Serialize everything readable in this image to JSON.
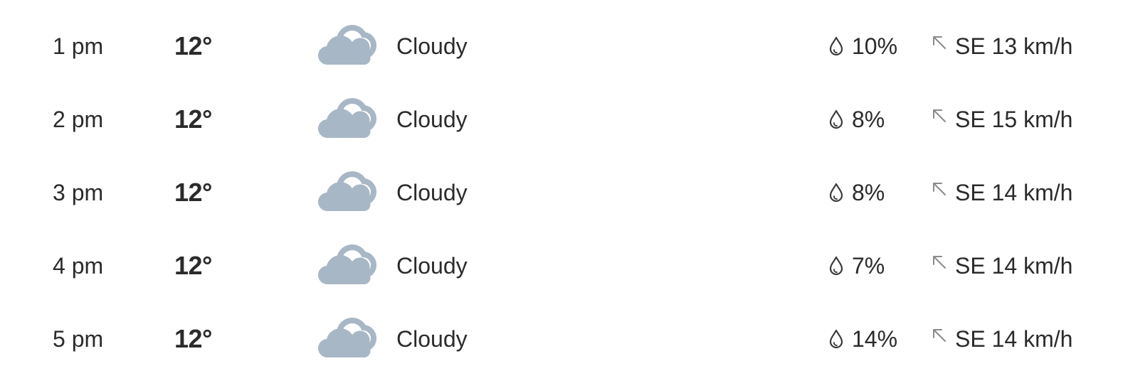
{
  "forecast": {
    "rows": [
      {
        "time": "1 pm",
        "temp": "12°",
        "condition": "Cloudy",
        "condition_icon": "partly-cloudy-icon",
        "precip": "10%",
        "wind": "SE 13 km/h"
      },
      {
        "time": "2 pm",
        "temp": "12°",
        "condition": "Cloudy",
        "condition_icon": "partly-cloudy-icon",
        "precip": "8%",
        "wind": "SE 15 km/h"
      },
      {
        "time": "3 pm",
        "temp": "12°",
        "condition": "Cloudy",
        "condition_icon": "partly-cloudy-icon",
        "precip": "8%",
        "wind": "SE 14 km/h"
      },
      {
        "time": "4 pm",
        "temp": "12°",
        "condition": "Cloudy",
        "condition_icon": "partly-cloudy-icon",
        "precip": "7%",
        "wind": "SE 14 km/h"
      },
      {
        "time": "5 pm",
        "temp": "12°",
        "condition": "Cloudy",
        "condition_icon": "partly-cloudy-icon",
        "precip": "14%",
        "wind": "SE 14 km/h"
      }
    ]
  },
  "colors": {
    "text": "#2b2b2b",
    "cloud": "#a8b7c5",
    "icon_stroke": "#3a3a3a",
    "wind_arrow": "#8a8a8a",
    "background": "#ffffff"
  }
}
